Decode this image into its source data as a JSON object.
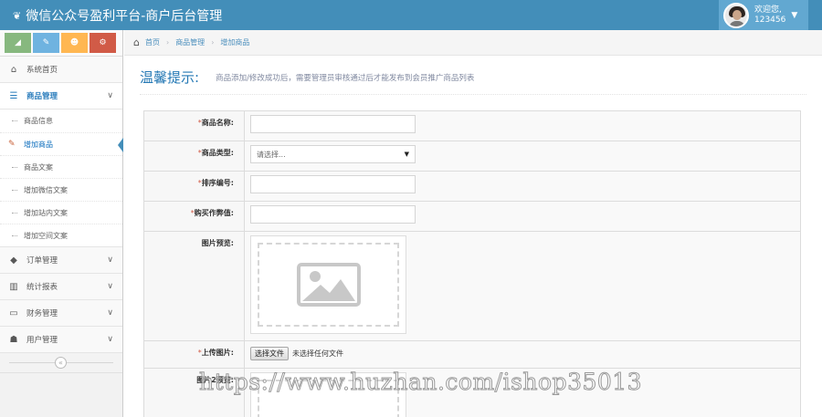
{
  "app": {
    "title": "微信公众号盈利平台-商户后台管理",
    "brand_icon": "leaf-icon"
  },
  "user": {
    "greeting": "欢迎您,",
    "name": "123456"
  },
  "colors": {
    "navbar": "#438eb9",
    "accent": "#2679b5",
    "shortcut_green": "#87b87f",
    "shortcut_blue": "#6fb3e0",
    "shortcut_orange": "#ffb752",
    "shortcut_red": "#d15b47"
  },
  "shortcuts": [
    {
      "icon": "signal-icon",
      "glyph": "◢"
    },
    {
      "icon": "pencil-icon",
      "glyph": "✎"
    },
    {
      "icon": "group-icon",
      "glyph": "☻"
    },
    {
      "icon": "cogs-icon",
      "glyph": "⚙"
    }
  ],
  "sidebar": {
    "items": [
      {
        "label": "系统首页",
        "icon": "home-icon",
        "glyph": "⌂"
      },
      {
        "label": "商品管理",
        "icon": "list-icon",
        "glyph": "☰"
      },
      {
        "label": "订单管理",
        "icon": "tag-icon",
        "glyph": "◆"
      },
      {
        "label": "统计报表",
        "icon": "bar-chart-icon",
        "glyph": "▥"
      },
      {
        "label": "财务管理",
        "icon": "credit-card-icon",
        "glyph": "▭"
      },
      {
        "label": "用户管理",
        "icon": "users-icon",
        "glyph": "☗"
      }
    ],
    "sub_items": [
      "商品信息",
      "增加商品",
      "商品文案",
      "增加微信文案",
      "增加站内文案",
      "增加空间文案"
    ]
  },
  "breadcrumb": {
    "home": "首页",
    "section": "商品管理",
    "current": "增加商品"
  },
  "page": {
    "title": "温馨提示:",
    "subtitle": "商品添加/修改成功后，需要管理员审核通过后才能发布到会员推广商品列表"
  },
  "form": {
    "required_mark": "*",
    "fields": {
      "name_label": "商品名称:",
      "type_label": "商品类型:",
      "type_placeholder": "请选择...",
      "sort_label": "排序编号:",
      "price_label": "购买作弊值:",
      "preview_label": "图片预览:",
      "upload_label": "上传图片:",
      "file_button": "选择文件",
      "file_status": "未选择任何文件",
      "preview2_label": "图片2预览:"
    }
  },
  "watermark": "https://www.huzhan.com/ishop35013"
}
